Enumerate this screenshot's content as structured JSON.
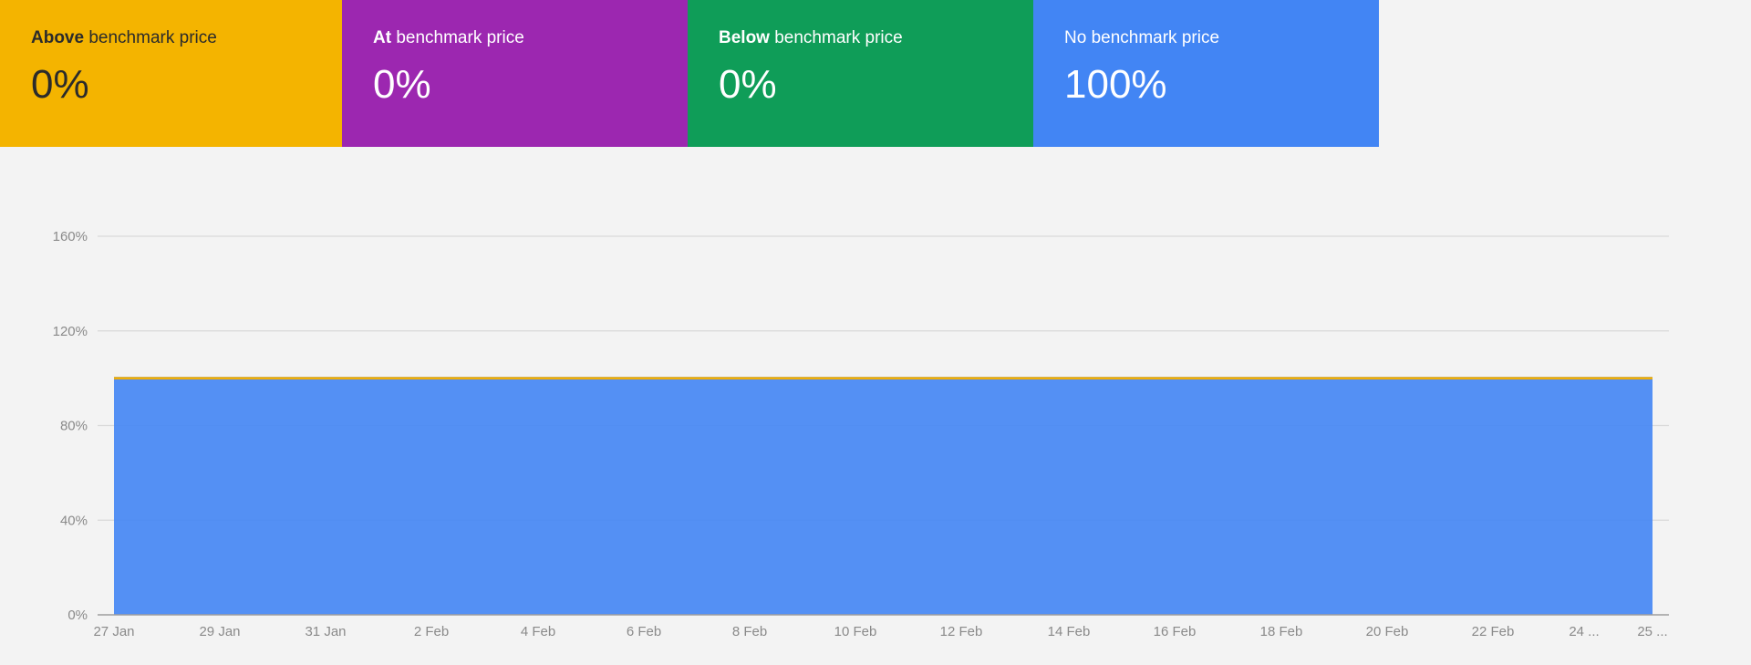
{
  "cards": [
    {
      "bold": "Above",
      "rest": " benchmark price",
      "value": "0%",
      "color": "#f4b400",
      "text_color": "#2b2b2b"
    },
    {
      "bold": "At",
      "rest": " benchmark price",
      "value": "0%",
      "color": "#9c27b0",
      "text_color": "#ffffff"
    },
    {
      "bold": "Below",
      "rest": " benchmark price",
      "value": "0%",
      "color": "#0f9d58",
      "text_color": "#ffffff"
    },
    {
      "bold": "",
      "rest": "No benchmark price",
      "value": "100%",
      "color": "#4285f4",
      "text_color": "#ffffff"
    }
  ],
  "chart_data": {
    "type": "area",
    "stacked": true,
    "x": [
      "27 Jan",
      "28 Jan",
      "29 Jan",
      "30 Jan",
      "31 Jan",
      "1 Feb",
      "2 Feb",
      "3 Feb",
      "4 Feb",
      "5 Feb",
      "6 Feb",
      "7 Feb",
      "8 Feb",
      "9 Feb",
      "10 Feb",
      "11 Feb",
      "12 Feb",
      "13 Feb",
      "14 Feb",
      "15 Feb",
      "16 Feb",
      "17 Feb",
      "18 Feb",
      "19 Feb",
      "20 Feb",
      "21 Feb",
      "22 Feb",
      "23 Feb",
      "24 Feb",
      "25 Feb"
    ],
    "x_tick_labels": [
      "27 Jan",
      "29 Jan",
      "31 Jan",
      "2 Feb",
      "4 Feb",
      "6 Feb",
      "8 Feb",
      "10 Feb",
      "12 Feb",
      "14 Feb",
      "16 Feb",
      "18 Feb",
      "20 Feb",
      "22 Feb",
      "24 ...",
      "25 ..."
    ],
    "y_tick_labels": [
      "0%",
      "40%",
      "80%",
      "120%",
      "160%"
    ],
    "ylim": [
      0,
      160
    ],
    "grid": true,
    "series": [
      {
        "name": "No benchmark price",
        "color": "#4285f4",
        "values": [
          100,
          100,
          100,
          100,
          100,
          100,
          100,
          100,
          100,
          100,
          100,
          100,
          100,
          100,
          100,
          100,
          100,
          100,
          100,
          100,
          100,
          100,
          100,
          100,
          100,
          100,
          100,
          100,
          100,
          100
        ]
      },
      {
        "name": "Below benchmark price",
        "color": "#0f9d58",
        "values": [
          0,
          0,
          0,
          0,
          0,
          0,
          0,
          0,
          0,
          0,
          0,
          0,
          0,
          0,
          0,
          0,
          0,
          0,
          0,
          0,
          0,
          0,
          0,
          0,
          0,
          0,
          0,
          0,
          0,
          0
        ]
      },
      {
        "name": "At benchmark price",
        "color": "#9c27b0",
        "values": [
          0,
          0,
          0,
          0,
          0,
          0,
          0,
          0,
          0,
          0,
          0,
          0,
          0,
          0,
          0,
          0,
          0,
          0,
          0,
          0,
          0,
          0,
          0,
          0,
          0,
          0,
          0,
          0,
          0,
          0
        ]
      },
      {
        "name": "Above benchmark price",
        "color": "#f4b400",
        "values": [
          0,
          0,
          0,
          0,
          0,
          0,
          0,
          0,
          0,
          0,
          0,
          0,
          0,
          0,
          0,
          0,
          0,
          0,
          0,
          0,
          0,
          0,
          0,
          0,
          0,
          0,
          0,
          0,
          0,
          0
        ]
      }
    ]
  }
}
